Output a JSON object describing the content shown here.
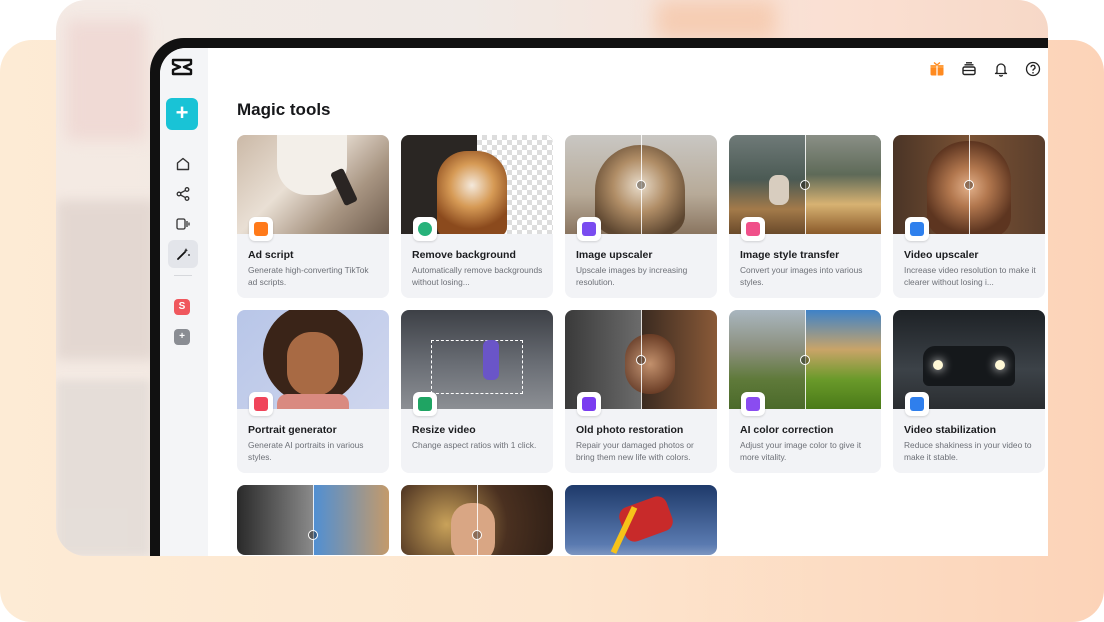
{
  "app": {
    "name": "CapCut"
  },
  "page": {
    "title": "Magic tools"
  },
  "sidebar": {
    "create_label": "+",
    "items": [
      {
        "icon": "home-icon"
      },
      {
        "icon": "share-icon"
      },
      {
        "icon": "video-icon"
      },
      {
        "icon": "magic-wand-icon",
        "active": true
      }
    ],
    "spaces": [
      {
        "label": "S",
        "color": "#f0585e"
      },
      {
        "label": "+",
        "color": "#8a8d93"
      }
    ]
  },
  "topbar": {
    "icons": [
      "gift-icon",
      "subscription-icon",
      "bell-icon",
      "help-icon"
    ]
  },
  "tools": [
    {
      "title": "Ad script",
      "desc": "Generate high-converting TikTok ad scripts.",
      "badge_color": "#ff7a1a",
      "icon": "ad-script-icon"
    },
    {
      "title": "Remove background",
      "desc": "Automatically remove backgrounds without losing...",
      "badge_color": "#27b27a",
      "icon": "remove-background-icon"
    },
    {
      "title": "Image upscaler",
      "desc": "Upscale images by increasing resolution.",
      "badge_color": "#7a4cf0",
      "icon": "image-upscaler-icon"
    },
    {
      "title": "Image style transfer",
      "desc": "Convert your images into various styles.",
      "badge_color": "#f0508a",
      "icon": "style-transfer-icon"
    },
    {
      "title": "Video upscaler",
      "desc": "Increase video resolution to make it clearer without losing i...",
      "badge_color": "#2f80ed",
      "icon": "video-upscaler-icon"
    },
    {
      "title": "Portrait generator",
      "desc": "Generate AI portraits in various styles.",
      "badge_color": "#f0445a",
      "icon": "portrait-generator-icon"
    },
    {
      "title": "Resize video",
      "desc": "Change aspect ratios with 1 click.",
      "badge_color": "#1fa463",
      "icon": "resize-video-icon"
    },
    {
      "title": "Old photo restoration",
      "desc": "Repair your damaged photos or bring them new life with colors.",
      "badge_color": "#7a3cf0",
      "icon": "photo-restoration-icon"
    },
    {
      "title": "AI color correction",
      "desc": "Adjust your image color to give it more vitality.",
      "badge_color": "#8a4cf0",
      "icon": "color-correction-icon"
    },
    {
      "title": "Video stabilization",
      "desc": "Reduce shakiness in your video to make it stable.",
      "badge_color": "#2f7fed",
      "icon": "video-stabilization-icon"
    },
    {
      "title": "",
      "desc": "",
      "badge_color": "",
      "icon": ""
    },
    {
      "title": "",
      "desc": "",
      "badge_color": "",
      "icon": ""
    },
    {
      "title": "",
      "desc": "",
      "badge_color": "",
      "icon": ""
    }
  ]
}
